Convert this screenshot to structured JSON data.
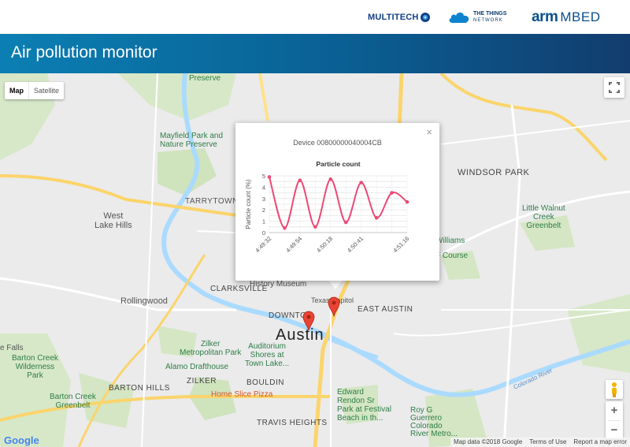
{
  "header": {
    "logos": [
      "MULTITECH",
      "THE THINGS NETWORK",
      "arm MBED"
    ],
    "multitech": "MULTITECH",
    "ttn_line1": "THE THINGS",
    "ttn_line2": "NETWORK",
    "arm_a": "arm",
    "arm_b": "MBED",
    "title": "Air pollution monitor"
  },
  "map_controls": {
    "map_label": "Map",
    "satellite_label": "Satellite",
    "selected": "Map",
    "zoom_in": "+",
    "zoom_out": "−",
    "icons": [
      "fullscreen-icon",
      "pegman-icon"
    ]
  },
  "map_labels": {
    "austin": "Austin",
    "west_lake_hills": "West\nLake Hills",
    "rollingwood": "Rollingwood",
    "tarrytown": "TARRYTOWN",
    "clarksville": "CLARKSVILLE",
    "downtown": "DOWNTO",
    "east_austin": "EAST AUSTIN",
    "windsor_park": "WINDSOR PARK",
    "mayfield_park": "Mayfield Park and\nNature Preserve",
    "zilker_park": "Zilker\nMetropolitan Park",
    "auditorium_shores": "Auditorium\nShores at\nTown Lake...",
    "alamo_drafthouse": "Alamo Drafthouse",
    "barton_hills": "BARTON HILLS",
    "bouldin": "BOULDIN",
    "zilker": "ZILKER",
    "travis_heights": "TRAVIS HEIGHTS",
    "home_slice": "Home Slice Pizza",
    "edward_rendon": "Edward\nRendon Sr\nPark at Festival\nBeach in th...",
    "roy_g": "Roy G\nGuerrero\nColorado\nRiver Metro...",
    "barton_creek_greenbelt": "Barton Creek\nGreenbelt",
    "barton_creek_wilderness": "Barton Creek\nWilderness\nPark",
    "little_walnut": "Little Walnut\nCreek\nGreenbelt",
    "history_museum": "History Museum",
    "texas_capitol": "Texas Capitol",
    "falls": "e Falls",
    "williams": "Williams",
    "golf": "F Course",
    "preserve": "Preserve",
    "colorado_river": "Colorado River"
  },
  "attribution": {
    "google": "Google",
    "map_data": "Map data ©2018 Google",
    "terms": "Terms of Use",
    "report": "Report a map error"
  },
  "popup": {
    "device": "Device 00800000040004CB",
    "close": "×"
  },
  "chart_data": {
    "type": "line",
    "title": "Particle count",
    "ylabel": "Particle count (%)",
    "xlabel": "",
    "ylim": [
      0,
      5
    ],
    "yticks": [
      0,
      0.5,
      1,
      1.5,
      2,
      2.5,
      3,
      3.5,
      4,
      4.5,
      5
    ],
    "x_tick_labels": [
      "4:49:32",
      "4:49:54",
      "4:50:18",
      "4:50:41",
      "4:51:16"
    ],
    "x": [
      "4:49:32",
      "4:49:43",
      "4:49:54",
      "4:50:06",
      "4:50:18",
      "4:50:29",
      "4:50:41",
      "4:50:53",
      "4:51:04",
      "4:51:16"
    ],
    "values": [
      4.9,
      0.4,
      4.6,
      0.5,
      4.7,
      0.9,
      4.4,
      1.3,
      3.5,
      2.7
    ],
    "grid": true,
    "line_color": "#ec4a76"
  }
}
